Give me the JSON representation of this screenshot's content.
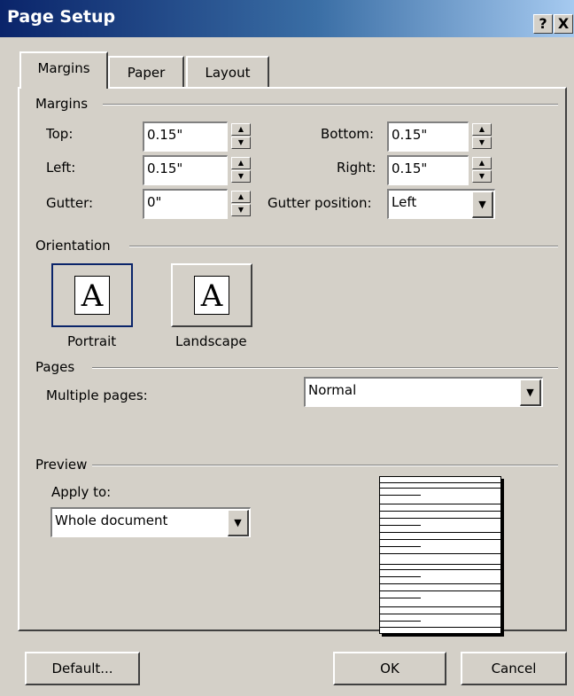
{
  "window": {
    "title": "Page Setup",
    "help_label": "?",
    "close_label": "X"
  },
  "tabs": [
    {
      "label": "Margins",
      "active": true
    },
    {
      "label": "Paper",
      "active": false
    },
    {
      "label": "Layout",
      "active": false
    }
  ],
  "margins": {
    "group_label": "Margins",
    "top": {
      "label": "Top:",
      "value": "0.15\""
    },
    "bottom": {
      "label": "Bottom:",
      "value": "0.15\""
    },
    "left": {
      "label": "Left:",
      "value": "0.15\""
    },
    "right": {
      "label": "Right:",
      "value": "0.15\""
    },
    "gutter": {
      "label": "Gutter:",
      "value": "0\""
    },
    "gutter_position": {
      "label": "Gutter position:",
      "value": "Left"
    }
  },
  "orientation": {
    "group_label": "Orientation",
    "portrait_label": "Portrait",
    "landscape_label": "Landscape",
    "icon_glyph": "A",
    "selected": "Portrait"
  },
  "pages": {
    "group_label": "Pages",
    "multiple_pages_label": "Multiple pages:",
    "multiple_pages_value": "Normal"
  },
  "preview": {
    "group_label": "Preview",
    "apply_to_label": "Apply to:",
    "apply_to_value": "Whole document"
  },
  "buttons": {
    "default_label": "Default...",
    "ok_label": "OK",
    "cancel_label": "Cancel"
  },
  "icons": {
    "spin_up": "▲",
    "spin_down": "▼",
    "dropdown": "▼"
  }
}
